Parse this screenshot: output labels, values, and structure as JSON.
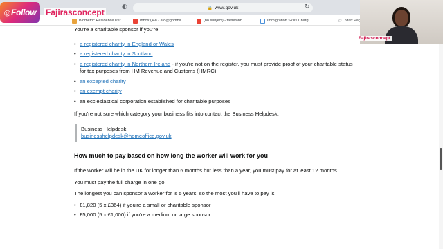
{
  "browser": {
    "url": "www.gov.uk",
    "bookmarks": [
      "Biometric Residence Per...",
      "Inbox (49) - afo@gomba...",
      "(no subject) - faithvanh...",
      "Immigration Skills Charg...",
      "Start Page"
    ]
  },
  "overlay": {
    "logo_text": "Follow",
    "brand_name": "Fajirasconcept",
    "webcam_label": "Fajirasconcept"
  },
  "content": {
    "lead": "You're a charitable sponsor if you're:",
    "sponsor_list": [
      {
        "link": "a registered charity in England or Wales",
        "suffix": ""
      },
      {
        "link": "a registered charity in Scotland",
        "suffix": ""
      },
      {
        "link": "a registered charity in Northern Ireland",
        "suffix": " - if you're not on the register, you must provide proof of your charitable status for tax purposes from HM Revenue and Customs (HMRC)"
      },
      {
        "link": "an excepted charity",
        "suffix": ""
      },
      {
        "link": "an exempt charity",
        "suffix": ""
      },
      {
        "link": "",
        "suffix": "an ecclesiastical corporation established for charitable purposes"
      }
    ],
    "unsure_text": "If you're not sure which category your business fits into contact the Business Helpdesk:",
    "helpdesk_name": "Business Helpdesk",
    "helpdesk_email": "businesshelpdesk@homeoffice.gov.uk",
    "heading": "How much to pay based on how long the worker will work for you",
    "para_longer": "If the worker will be in the UK for longer than 6 months but less than a year, you must pay for at least 12 months.",
    "para_full": "You must pay the full charge in one go.",
    "para_longest": "The longest you can sponsor a worker for is 5 years, so the most you'll have to pay is:",
    "cost_list": [
      "£1,820 (5 x £364) if you're a small or charitable sponsor",
      "£5,000 (5 x £1,000) if you're a medium or large sponsor"
    ]
  }
}
